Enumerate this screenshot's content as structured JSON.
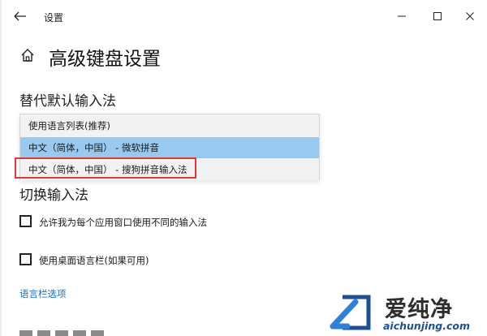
{
  "window": {
    "title": "设置"
  },
  "header": {
    "page_title": "高级键盘设置"
  },
  "default_input": {
    "heading": "替代默认输入法",
    "options": [
      {
        "label": "使用语言列表(推荐)"
      },
      {
        "label": "中文（简体，中国） - 微软拼音"
      },
      {
        "label": "中文（简体，中国） - 搜狗拼音输入法"
      }
    ],
    "highlighted_index": 1,
    "outlined_index": 2
  },
  "switch_input": {
    "heading": "切换输入法",
    "checkboxes": [
      {
        "label": "允许我为每个应用窗口使用不同的输入法",
        "checked": false
      },
      {
        "label": "使用桌面语言栏(如果可用)",
        "checked": false
      }
    ],
    "link_label": "语言栏选项"
  },
  "watermark": {
    "brand": "爱纯净",
    "url": "aichunjing.com"
  },
  "colors": {
    "highlight": "#99c9ef",
    "outline": "#d93a3a",
    "link": "#1a6fc9",
    "watermark_url": "#1d4f91"
  }
}
